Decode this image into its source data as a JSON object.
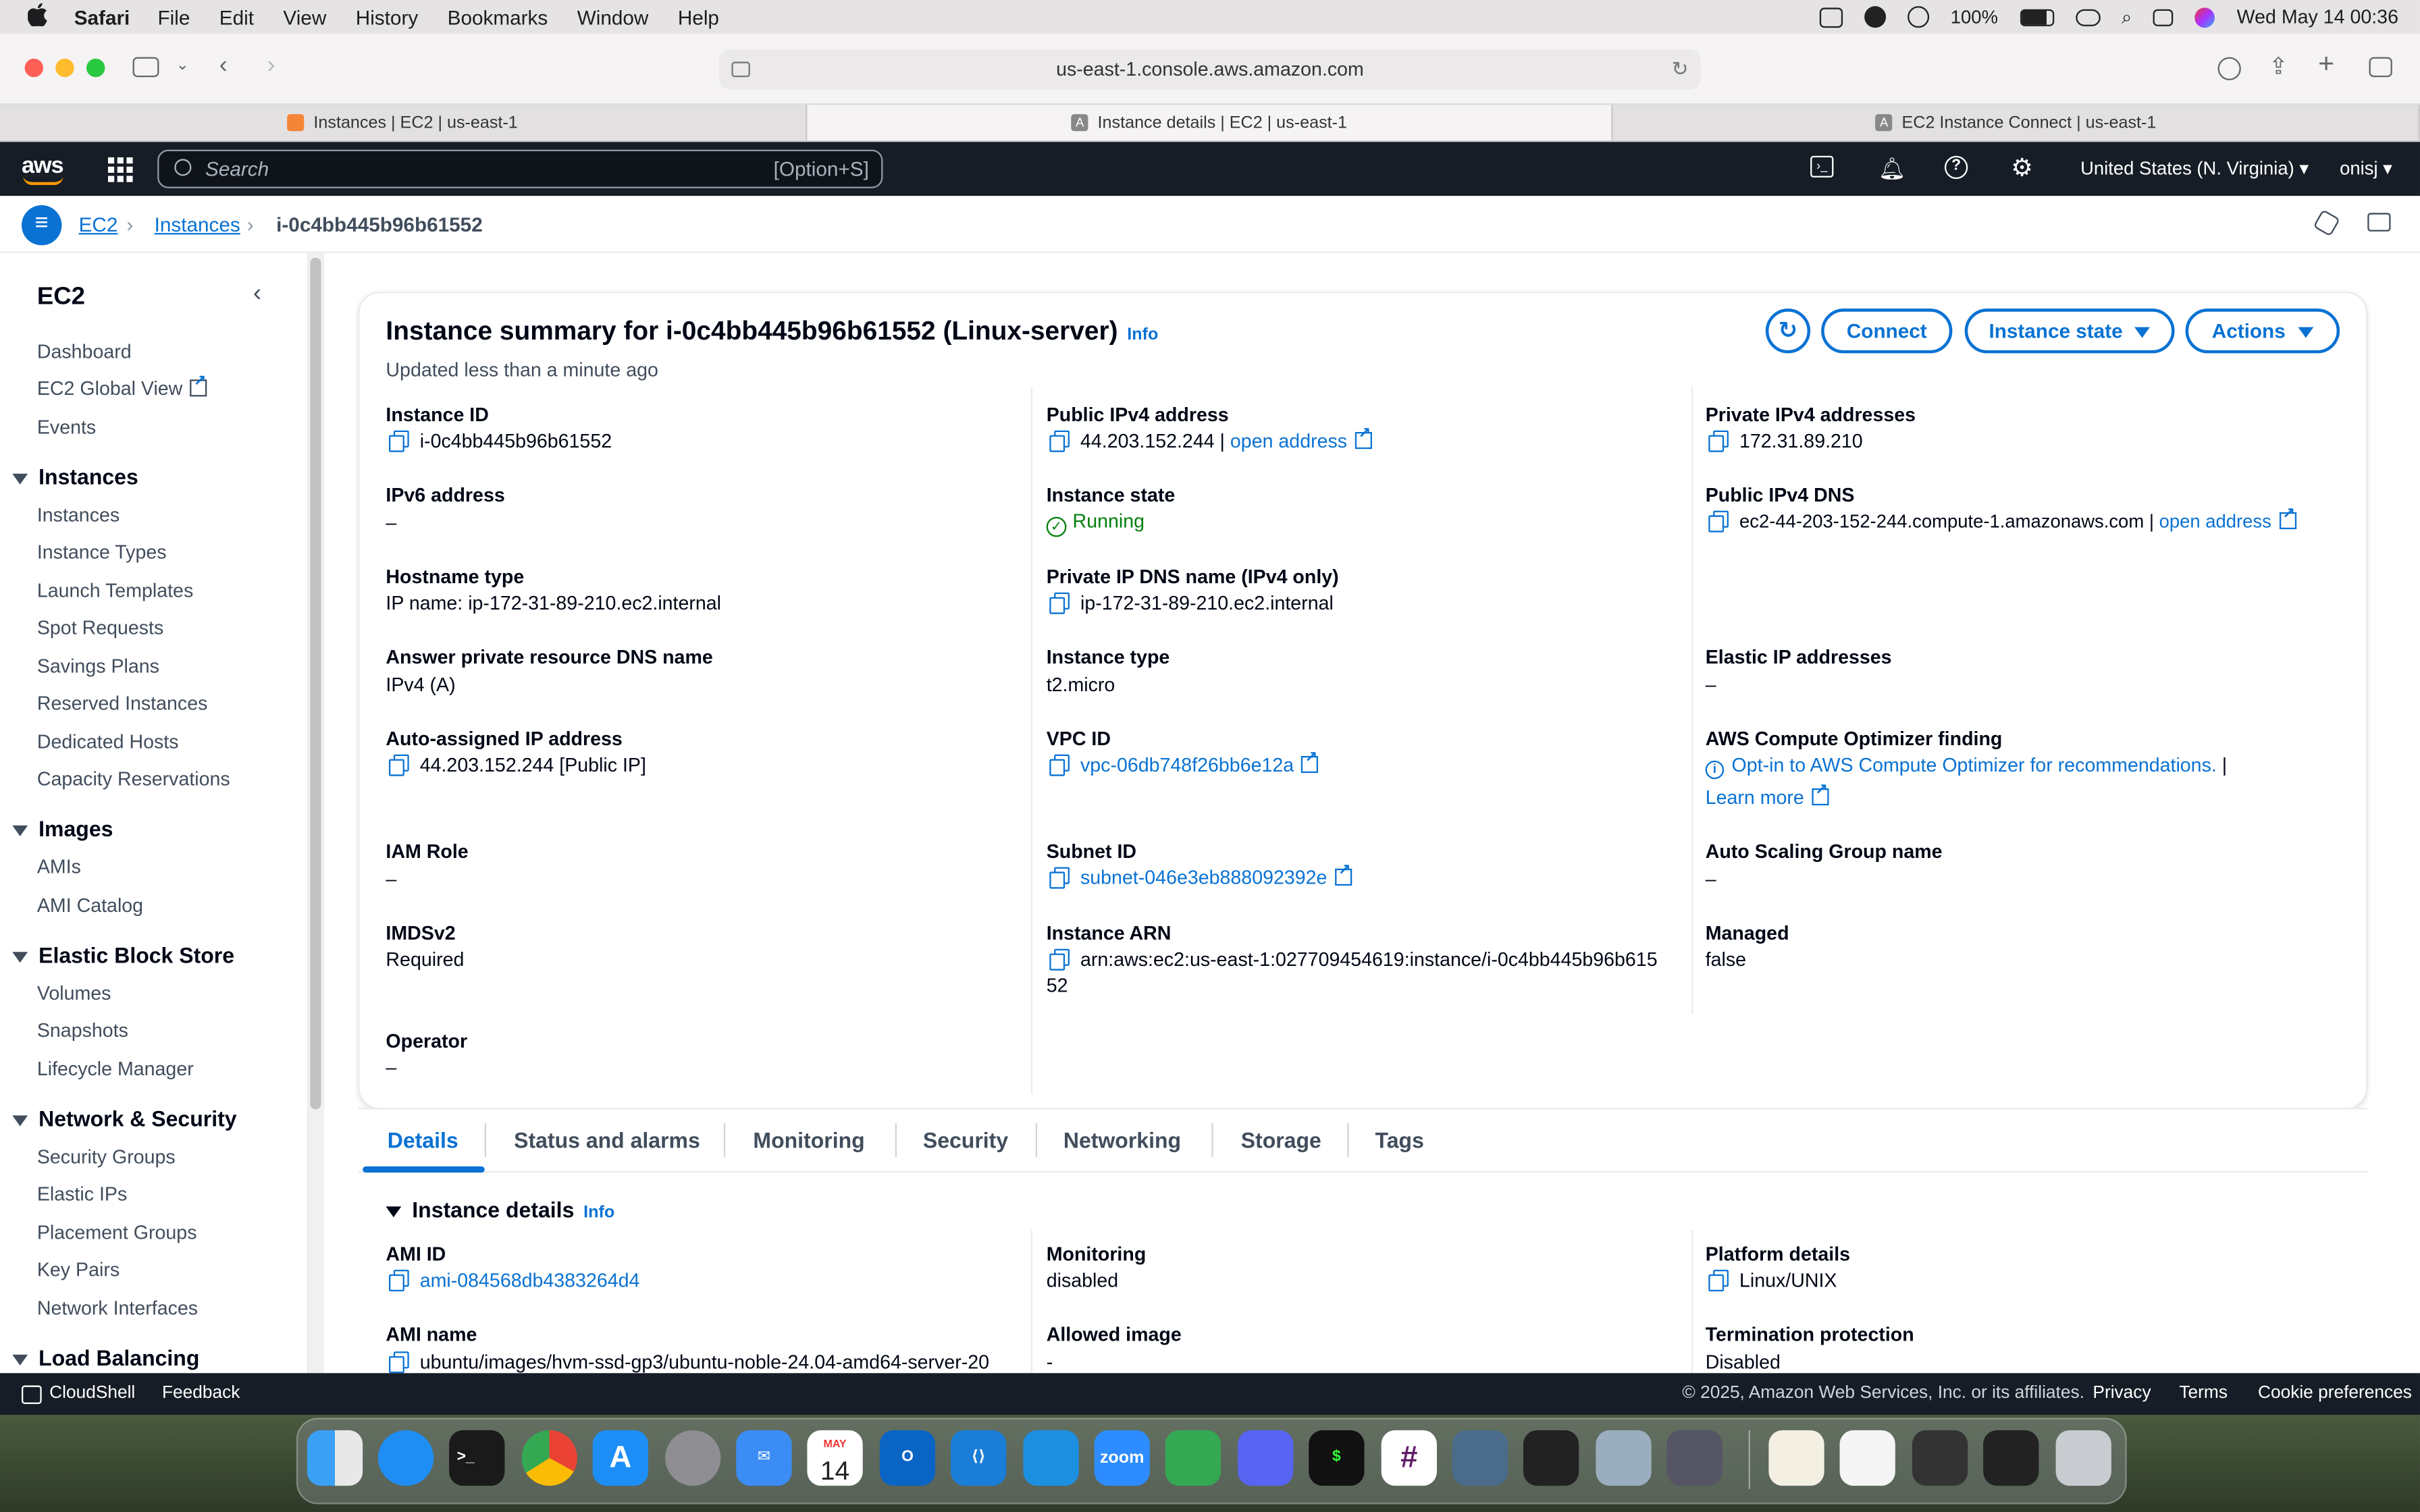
{
  "menubar": {
    "items": [
      "Safari",
      "File",
      "Edit",
      "View",
      "History",
      "Bookmarks",
      "Window",
      "Help"
    ],
    "battery": "100%",
    "clock": "Wed May 14  00:36"
  },
  "browser": {
    "url": "us-east-1.console.aws.amazon.com",
    "tabs": [
      {
        "label": "Instances | EC2 | us-east-1",
        "color": "#f58536"
      },
      {
        "label": "Instance details | EC2 | us-east-1",
        "color": "#888888"
      },
      {
        "label": "EC2 Instance Connect | us-east-1",
        "color": "#888888"
      }
    ]
  },
  "aws_header": {
    "logo": "aws",
    "search_placeholder": "Search",
    "search_shortcut": "[Option+S]",
    "region": "United States (N. Virginia)",
    "user": "onisj"
  },
  "breadcrumb": [
    "EC2",
    "Instances",
    "i-0c4bb445b96b61552"
  ],
  "sidebar": {
    "title": "EC2",
    "top_items": [
      "Dashboard",
      "EC2 Global View",
      "Events"
    ],
    "sections": [
      {
        "title": "Instances",
        "items": [
          "Instances",
          "Instance Types",
          "Launch Templates",
          "Spot Requests",
          "Savings Plans",
          "Reserved Instances",
          "Dedicated Hosts",
          "Capacity Reservations"
        ]
      },
      {
        "title": "Images",
        "items": [
          "AMIs",
          "AMI Catalog"
        ]
      },
      {
        "title": "Elastic Block Store",
        "items": [
          "Volumes",
          "Snapshots",
          "Lifecycle Manager"
        ]
      },
      {
        "title": "Network & Security",
        "items": [
          "Security Groups",
          "Elastic IPs",
          "Placement Groups",
          "Key Pairs",
          "Network Interfaces"
        ]
      },
      {
        "title": "Load Balancing",
        "items": []
      }
    ]
  },
  "summary": {
    "title": "Instance summary for i-0c4bb445b96b61552 (Linux-server)",
    "info": "Info",
    "updated": "Updated less than a minute ago",
    "buttons": {
      "connect": "Connect",
      "instance_state": "Instance state",
      "actions": "Actions"
    },
    "open_address": "open address",
    "fields": {
      "instance_id": {
        "label": "Instance ID",
        "value": "i-0c4bb445b96b61552"
      },
      "public_ipv4": {
        "label": "Public IPv4 address",
        "value": "44.203.152.244"
      },
      "private_ipv4": {
        "label": "Private IPv4 addresses",
        "value": "172.31.89.210"
      },
      "ipv6": {
        "label": "IPv6 address",
        "value": "–"
      },
      "state": {
        "label": "Instance state",
        "value": "Running"
      },
      "public_dns": {
        "label": "Public IPv4 DNS",
        "value": "ec2-44-203-152-244.compute-1.amazonaws.com"
      },
      "hostname_type": {
        "label": "Hostname type",
        "value": "IP name: ip-172-31-89-210.ec2.internal"
      },
      "private_dns": {
        "label": "Private IP DNS name (IPv4 only)",
        "value": "ip-172-31-89-210.ec2.internal"
      },
      "answer_dns": {
        "label": "Answer private resource DNS name",
        "value": "IPv4 (A)"
      },
      "instance_type": {
        "label": "Instance type",
        "value": "t2.micro"
      },
      "elastic_ip": {
        "label": "Elastic IP addresses",
        "value": "–"
      },
      "auto_ip": {
        "label": "Auto-assigned IP address",
        "value": "44.203.152.244 [Public IP]"
      },
      "vpc": {
        "label": "VPC ID",
        "value": "vpc-06db748f26bb6e12a"
      },
      "optimizer": {
        "label": "AWS Compute Optimizer finding",
        "value": "Opt-in to AWS Compute Optimizer for recommendations.",
        "learn": "Learn more"
      },
      "iam": {
        "label": "IAM Role",
        "value": "–"
      },
      "subnet": {
        "label": "Subnet ID",
        "value": "subnet-046e3eb888092392e"
      },
      "asg": {
        "label": "Auto Scaling Group name",
        "value": "–"
      },
      "imds": {
        "label": "IMDSv2",
        "value": "Required"
      },
      "arn": {
        "label": "Instance ARN",
        "value1": "arn:aws:ec2:us-east-1:027709454619:instance/i-0c4bb445b96b615",
        "value2": "52"
      },
      "managed": {
        "label": "Managed",
        "value": "false"
      },
      "operator": {
        "label": "Operator",
        "value": "–"
      }
    }
  },
  "detail_tabs": [
    "Details",
    "Status and alarms",
    "Monitoring",
    "Security",
    "Networking",
    "Storage",
    "Tags"
  ],
  "instance_details": {
    "title": "Instance details",
    "info": "Info",
    "ami_id": {
      "label": "AMI ID",
      "value": "ami-084568db4383264d4"
    },
    "monitoring": {
      "label": "Monitoring",
      "value": "disabled"
    },
    "platform": {
      "label": "Platform details",
      "value": "Linux/UNIX"
    },
    "ami_name": {
      "label": "AMI name",
      "value": "ubuntu/images/hvm-ssd-gp3/ubuntu-noble-24.04-amd64-server-20"
    },
    "allowed_image": {
      "label": "Allowed image",
      "value": "-"
    },
    "termination": {
      "label": "Termination protection",
      "value": "Disabled"
    }
  },
  "footer": {
    "cloudshell": "CloudShell",
    "feedback": "Feedback",
    "copyright": "© 2025, Amazon Web Services, Inc. or its affiliates.",
    "privacy": "Privacy",
    "terms": "Terms",
    "cookies": "Cookie preferences"
  },
  "dock": {
    "calendar_month": "MAY",
    "calendar_day": "14",
    "zoom": "zoom"
  }
}
